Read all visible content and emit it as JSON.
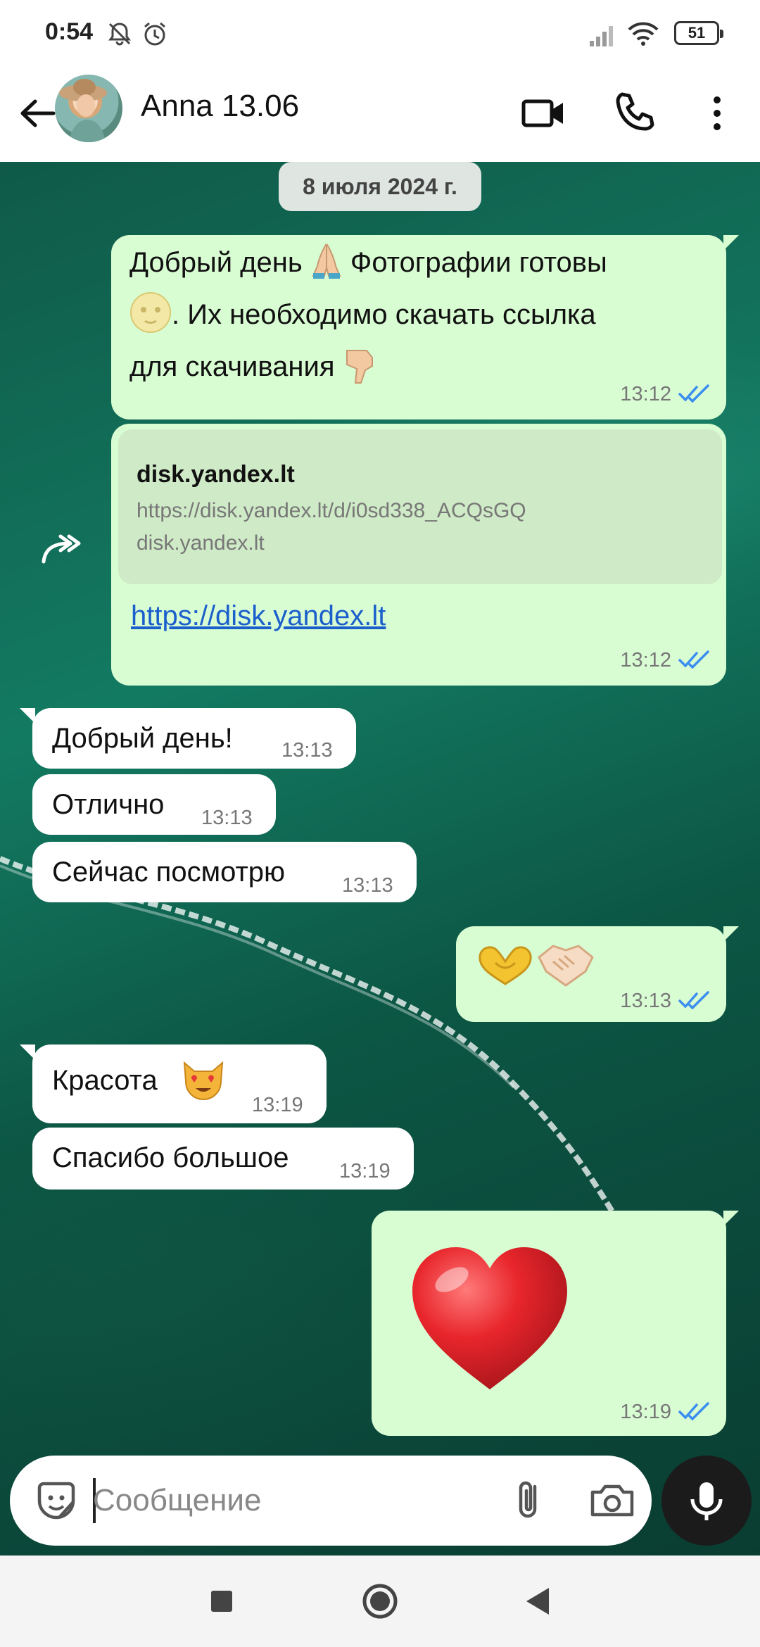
{
  "status_bar": {
    "time": "0:54",
    "battery": "51"
  },
  "header": {
    "contact_name": "Anna 13.06"
  },
  "chat": {
    "date_label": "8 июля 2024 г.",
    "messages": [
      {
        "dir": "out",
        "text_1a": "Добрый день",
        "text_1b": "Фотографии готовы",
        "text_2": ". Их необходимо скачать ссылка",
        "text_3": "для скачивания",
        "time": "13:12"
      },
      {
        "dir": "out",
        "preview_title": "disk.yandex.lt",
        "preview_url": "https://disk.yandex.lt/d/i0sd338_ACQsGQ",
        "preview_domain": "disk.yandex.lt",
        "link": "https://disk.yandex.lt",
        "time": "13:12"
      },
      {
        "dir": "in",
        "text": "Добрый день!",
        "time": "13:13"
      },
      {
        "dir": "in",
        "text": "Отлично",
        "time": "13:13"
      },
      {
        "dir": "in",
        "text": "Сейчас посмотрю",
        "time": "13:13"
      },
      {
        "dir": "out",
        "emoji": "heart-hands, handshake",
        "time": "13:13"
      },
      {
        "dir": "in",
        "text": "Красота",
        "time": "13:19"
      },
      {
        "dir": "in",
        "text": "Спасибо большое",
        "time": "13:19"
      },
      {
        "dir": "out",
        "emoji": "red-heart",
        "time": "13:19"
      }
    ]
  },
  "input": {
    "placeholder": "Сообщение"
  },
  "colors": {
    "outgoing_bubble": "#d9fdd3",
    "incoming_bubble": "#ffffff",
    "read_ticks": "#3b8ef0",
    "link": "#1a5fcc"
  }
}
